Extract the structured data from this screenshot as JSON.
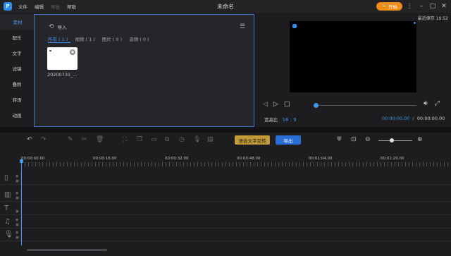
{
  "app": {
    "logo": "P",
    "title": "未命名",
    "menu": [
      "文件",
      "编辑",
      "导出",
      "帮助"
    ],
    "upgrade_label": "开始",
    "window_icons": [
      "kebab-icon",
      "minimize-icon",
      "maximize-icon",
      "close-icon"
    ]
  },
  "sidebar": {
    "items": [
      {
        "label": "素材",
        "active": true
      },
      {
        "label": "配乐",
        "active": false
      },
      {
        "label": "文字",
        "active": false
      },
      {
        "label": "滤镜",
        "active": false
      },
      {
        "label": "叠附",
        "active": false
      },
      {
        "label": "转场",
        "active": false
      },
      {
        "label": "动画",
        "active": false
      }
    ]
  },
  "library": {
    "import_label": "导入",
    "filters": [
      "所有 ( 1 )",
      "视频 ( 1 )",
      "图片 ( 0 )",
      "音频 ( 0 )"
    ],
    "media": [
      {
        "name": "20200731_..."
      }
    ]
  },
  "preview": {
    "autosave": "最近保存 19:52",
    "ratio_label": "宽高比",
    "ratio_value": "16 : 9",
    "current_time": "00:00:00.00",
    "separator": "/",
    "total_time": "00:00:00.00"
  },
  "toolbar": {
    "tts_label": "语音文字互转",
    "export_label": "导出"
  },
  "timeline": {
    "ruler_labels": [
      "00:00:00.00",
      "00:00:16.00",
      "00:00:32.00",
      "00:00:48.00",
      "00:01:04.00",
      "00:01:20.00"
    ],
    "tracks": [
      "video-track-icon",
      "film-track-icon",
      "text-track-icon",
      "music-track-icon",
      "mic-track-icon"
    ]
  },
  "colors": {
    "accent": "#3f93ea",
    "upgrade": "#f08a18",
    "tts_button": "#c49a38",
    "export_button": "#2b6fd6"
  }
}
